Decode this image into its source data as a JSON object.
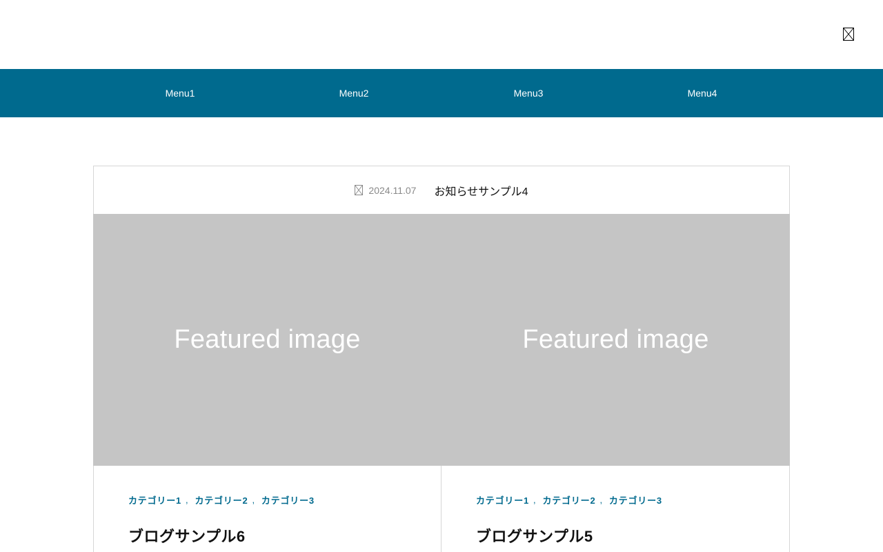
{
  "header": {
    "menu_toggle_icon": "broken-glyph-icon"
  },
  "nav": {
    "items": [
      {
        "label": "Menu1"
      },
      {
        "label": "Menu2"
      },
      {
        "label": "Menu3"
      },
      {
        "label": "Menu4"
      }
    ],
    "background_color": "#006a8e"
  },
  "news": {
    "icon": "clock-icon",
    "date": "2024.11.07",
    "title": "お知らせサンプル4"
  },
  "posts": [
    {
      "thumbnail_text": "Featured image",
      "categories": [
        "カテゴリー1",
        "カテゴリー2",
        "カテゴリー3"
      ],
      "separator": ",",
      "title": "ブログサンプル6"
    },
    {
      "thumbnail_text": "Featured image",
      "categories": [
        "カテゴリー1",
        "カテゴリー2",
        "カテゴリー3"
      ],
      "separator": ",",
      "title": "ブログサンプル5"
    }
  ],
  "colors": {
    "accent": "#006a8e",
    "thumbnail_bg": "#c5c5c5",
    "border": "#d6d6d6",
    "date_text": "#8a8a8a"
  }
}
